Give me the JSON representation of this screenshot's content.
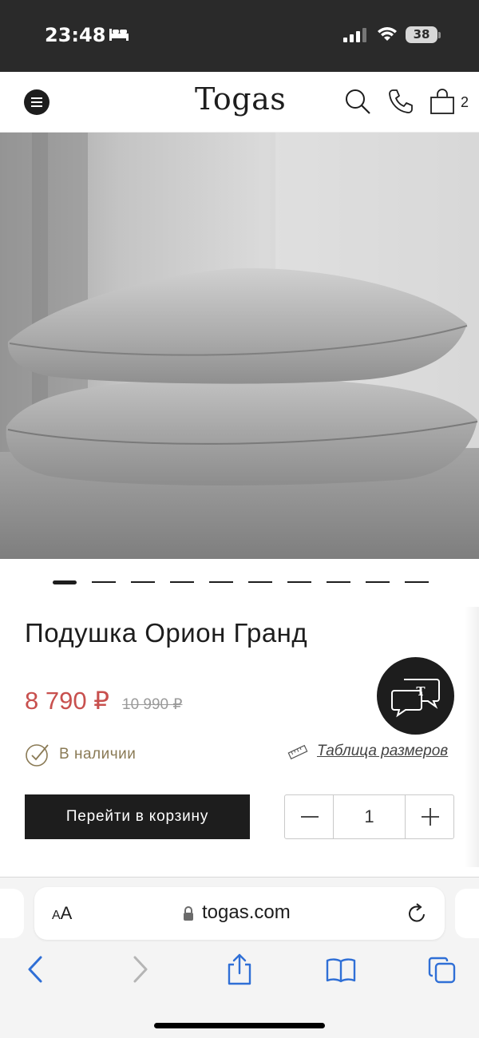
{
  "status_bar": {
    "time": "23:48",
    "battery": "38"
  },
  "header": {
    "logo": "Togas",
    "cart_count": "2"
  },
  "product": {
    "title": "Подушка Орион Гранд",
    "price": "8 790 ₽",
    "old_price": "10 990 ₽",
    "stock_status": "В наличии",
    "size_table_link": "Таблица размеров",
    "cart_button": "Перейти в корзину",
    "quantity": "1",
    "carousel": {
      "total": 10,
      "active": 1
    }
  },
  "chat": {
    "badge_letter": "T"
  },
  "browser": {
    "text_size_label_small": "A",
    "text_size_label_big": "A",
    "url": "togas.com"
  },
  "colors": {
    "price_red": "#c8504e",
    "stock_gold": "#8a7a55",
    "dark": "#1d1d1d"
  }
}
